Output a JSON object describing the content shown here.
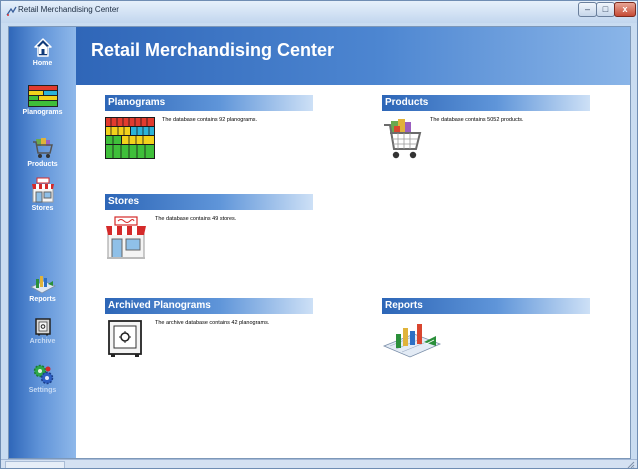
{
  "window": {
    "title": "Retail Merchandising Center",
    "min_glyph": "–",
    "max_glyph": "□",
    "close_glyph": "x"
  },
  "sidebar": {
    "items": [
      {
        "label": "Home",
        "icon": "home-icon",
        "enabled": true
      },
      {
        "label": "Planograms",
        "icon": "planogram-icon",
        "enabled": true
      },
      {
        "label": "Products",
        "icon": "shopping-cart-icon",
        "enabled": true
      },
      {
        "label": "Stores",
        "icon": "store-icon",
        "enabled": true
      },
      {
        "label": "Reports",
        "icon": "reports-icon",
        "enabled": true
      },
      {
        "label": "Archive",
        "icon": "safe-icon",
        "enabled": false
      },
      {
        "label": "Settings",
        "icon": "gears-icon",
        "enabled": false
      }
    ]
  },
  "main": {
    "title": "Retail Merchandising Center",
    "sections": {
      "planograms": {
        "title": "Planograms",
        "description": "The database contains 92 planograms."
      },
      "products": {
        "title": "Products",
        "description": "The database contains 5052 products."
      },
      "stores": {
        "title": "Stores",
        "description": "The database contains 49 stores."
      },
      "archived": {
        "title": "Archived Planograms",
        "description": "The archive database contains 42 planograms."
      },
      "reports": {
        "title": "Reports",
        "description": ""
      }
    }
  },
  "colors": {
    "sidebar_dark": "#2f67b9",
    "sidebar_light": "#8fb8ea",
    "header_dark": "#2d66b7",
    "header_light": "#cde0f6",
    "store_awning_red": "#d42a2a"
  }
}
